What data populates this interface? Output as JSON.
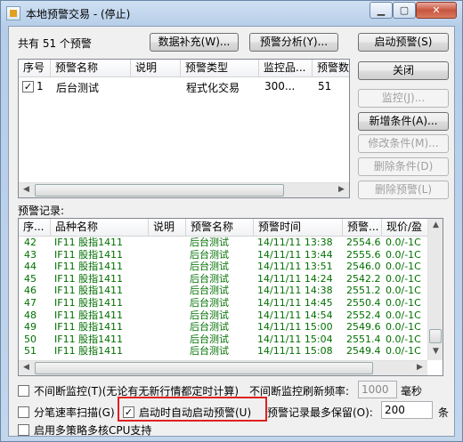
{
  "window": {
    "title": "本地预警交易 - (停止)"
  },
  "summary": "共有 51 个预警",
  "buttons": {
    "data_fill": "数据补充(W)...",
    "analysis": "预警分析(Y)...",
    "start": "启动预警(S)",
    "close": "关闭",
    "monitor": "监控(J)...",
    "add_cond": "新增条件(A)...",
    "edit_cond": "修改条件(M)...",
    "del_cond": "删除条件(D)",
    "del_alert": "删除预警(L)"
  },
  "alert_list": {
    "headers": [
      "序号",
      "预警名称",
      "说明",
      "预警类型",
      "监控品...",
      "预警数"
    ],
    "rows": [
      {
        "id": "1",
        "name": "后台测试",
        "desc": "",
        "type": "程式化交易",
        "product": "300...",
        "count": "51",
        "checked": true
      }
    ]
  },
  "records_label": "预警记录:",
  "records": {
    "headers": [
      "序...",
      "品种名称",
      "说明",
      "预警名称",
      "预警时间",
      "预警...",
      "现价/盈"
    ],
    "rows": [
      {
        "seq": "42",
        "product": "IF11 股指1411",
        "desc": "",
        "name": "后台测试",
        "time": "14/11/11 13:38",
        "price": "2554.6",
        "pnl": "0.0/-1C"
      },
      {
        "seq": "43",
        "product": "IF11 股指1411",
        "desc": "",
        "name": "后台测试",
        "time": "14/11/11 13:44",
        "price": "2555.6",
        "pnl": "0.0/-1C"
      },
      {
        "seq": "44",
        "product": "IF11 股指1411",
        "desc": "",
        "name": "后台测试",
        "time": "14/11/11 13:51",
        "price": "2546.0",
        "pnl": "0.0/-1C"
      },
      {
        "seq": "45",
        "product": "IF11 股指1411",
        "desc": "",
        "name": "后台测试",
        "time": "14/11/11 14:24",
        "price": "2542.2",
        "pnl": "0.0/-1C"
      },
      {
        "seq": "46",
        "product": "IF11 股指1411",
        "desc": "",
        "name": "后台测试",
        "time": "14/11/11 14:38",
        "price": "2551.2",
        "pnl": "0.0/-1C"
      },
      {
        "seq": "47",
        "product": "IF11 股指1411",
        "desc": "",
        "name": "后台测试",
        "time": "14/11/11 14:45",
        "price": "2550.4",
        "pnl": "0.0/-1C"
      },
      {
        "seq": "48",
        "product": "IF11 股指1411",
        "desc": "",
        "name": "后台测试",
        "time": "14/11/11 14:54",
        "price": "2552.4",
        "pnl": "0.0/-1C"
      },
      {
        "seq": "49",
        "product": "IF11 股指1411",
        "desc": "",
        "name": "后台测试",
        "time": "14/11/11 15:00",
        "price": "2549.6",
        "pnl": "0.0/-1C"
      },
      {
        "seq": "50",
        "product": "IF11 股指1411",
        "desc": "",
        "name": "后台测试",
        "time": "14/11/11 15:04",
        "price": "2551.4",
        "pnl": "0.0/-1C"
      },
      {
        "seq": "51",
        "product": "IF11 股指1411",
        "desc": "",
        "name": "后台测试",
        "time": "14/11/11 15:08",
        "price": "2549.4",
        "pnl": "0.0/-1C"
      }
    ]
  },
  "options": {
    "continuous_monitor": "不间断监控(T)(无论有无新行情都定时计算)",
    "refresh_label": "不间断监控刷新频率:",
    "refresh_value": "1000",
    "refresh_unit": "毫秒",
    "tick_scan": "分笔速率扫描(G)",
    "auto_start": "启动时自动启动预警(U)",
    "auto_start_checked": true,
    "max_records_label": "预警记录最多保留(O):",
    "max_records_value": "200",
    "max_records_unit": "条",
    "multi_cpu": "启用多策略多核CPU支持"
  },
  "colors": {
    "record_text": "#007000",
    "highlight_border": "#e02020"
  }
}
